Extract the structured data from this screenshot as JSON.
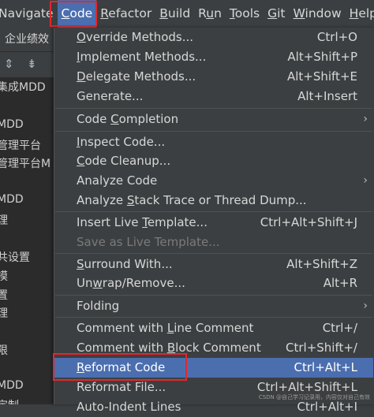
{
  "menubar": {
    "items": [
      {
        "label": "Navigate",
        "u": ""
      },
      {
        "label": "Code",
        "u": "C"
      },
      {
        "label": "Refactor",
        "u": "R"
      },
      {
        "label": "Build",
        "u": "B"
      },
      {
        "label": "Run",
        "u": "u"
      },
      {
        "label": "Tools",
        "u": "T"
      },
      {
        "label": "Git",
        "u": "G"
      },
      {
        "label": "Window",
        "u": "W"
      },
      {
        "label": "Help",
        "u": "H"
      }
    ]
  },
  "sidebar": {
    "tab_label": "企业绩效",
    "lines": [
      "集成MDD",
      "MDD",
      "管理平台",
      "管理平台M",
      "MDD",
      "理",
      "共设置",
      "模",
      "置",
      "理",
      "限",
      "MDD",
      "定制"
    ]
  },
  "menu": {
    "override": {
      "pre": "",
      "u": "O",
      "post": "verride Methods...",
      "shortcut": "Ctrl+O"
    },
    "implement": {
      "pre": "",
      "u": "I",
      "post": "mplement Methods...",
      "shortcut": "Alt+Shift+P"
    },
    "delegate": {
      "pre": "",
      "u": "D",
      "post": "elegate Methods...",
      "shortcut": "Alt+Shift+E"
    },
    "generate": {
      "pre": "Generate...",
      "u": "",
      "post": "",
      "shortcut": "Alt+Insert"
    },
    "completion": {
      "pre": "Code ",
      "u": "C",
      "post": "ompletion",
      "shortcut": ""
    },
    "inspect": {
      "pre": "",
      "u": "I",
      "post": "nspect Code...",
      "shortcut": ""
    },
    "cleanup": {
      "pre": "",
      "u": "C",
      "post": "ode Cleanup...",
      "shortcut": ""
    },
    "analyze": {
      "pre": "Analyze Code",
      "u": "",
      "post": "",
      "shortcut": ""
    },
    "stacktrace": {
      "pre": "Analyze ",
      "u": "S",
      "post": "tack Trace or Thread Dump...",
      "shortcut": ""
    },
    "insert_live": {
      "pre": "Insert Live ",
      "u": "T",
      "post": "emplate...",
      "shortcut": "Ctrl+Alt+Shift+J"
    },
    "save_live": {
      "pre": "Save as Live Template...",
      "u": "",
      "post": "",
      "shortcut": ""
    },
    "surround": {
      "pre": "",
      "u": "S",
      "post": "urround With...",
      "shortcut": "Alt+Shift+Z"
    },
    "unwrap": {
      "pre": "Un",
      "u": "w",
      "post": "rap/Remove...",
      "shortcut": "Alt+R"
    },
    "folding": {
      "pre": "Folding",
      "u": "",
      "post": "",
      "shortcut": ""
    },
    "line_comment": {
      "pre": "Comment with ",
      "u": "L",
      "post": "ine Comment",
      "shortcut": "Ctrl+/"
    },
    "block_comment": {
      "pre": "Comment with ",
      "u": "B",
      "post": "lock Comment",
      "shortcut": "Ctrl+Shift+/"
    },
    "reformat_code": {
      "pre": "",
      "u": "R",
      "post": "eformat Code",
      "shortcut": "Ctrl+Alt+L"
    },
    "reformat_file": {
      "pre": "Reformat File...",
      "u": "",
      "post": "",
      "shortcut": "Ctrl+Alt+Shift+L"
    },
    "auto_indent": {
      "pre": "Auto-Indent Lines",
      "u": "",
      "post": "",
      "shortcut": "Ctrl+Alt+I"
    }
  },
  "watermark": "CSDN @自己学习记录用，内容仅对自己有效",
  "colors": {
    "selection": "#4b6eaf",
    "highlight_box": "#e0282d",
    "menu_bg": "#3c3f41"
  }
}
